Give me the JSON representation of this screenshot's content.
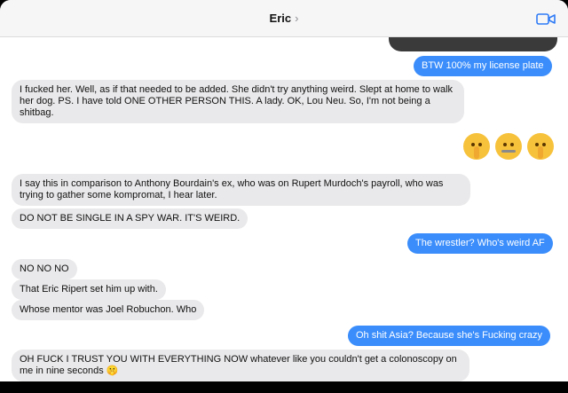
{
  "header": {
    "contact_name": "Eric",
    "chevron": "›",
    "video_icon": "video-camera-icon"
  },
  "colors": {
    "incoming_bubble": "#e9e9eb",
    "outgoing_bubble": "#3a8dfb",
    "header_bg": "#f6f6f7"
  },
  "messages": [
    {
      "from": "me",
      "text": "BTW 100% my license plate"
    },
    {
      "from": "them",
      "text": "I fucked her. Well, as if that needed to be added. She didn't try anything weird. Slept at home to walk her dog. PS. I have told ONE OTHER PERSON THIS. A lady. OK, Lou Neu. So, I'm not being a shitbag."
    },
    {
      "from": "me",
      "text": "🤫🤐🤫"
    },
    {
      "from": "them",
      "text": "I say this in comparison to Anthony Bourdain's ex, who was on Rupert Murdoch's payroll, who was trying to gather some kompromat, I hear later."
    },
    {
      "from": "them",
      "text": "DO NOT BE SINGLE IN A SPY WAR. IT'S WEIRD."
    },
    {
      "from": "me",
      "text": "The wrestler? Who's weird AF"
    },
    {
      "from": "them",
      "text": "NO NO NO"
    },
    {
      "from": "them",
      "text": "That Eric Ripert set him up with."
    },
    {
      "from": "them",
      "text": "Whose mentor was Joel Robuchon. Who"
    },
    {
      "from": "me",
      "text": "Oh shit Asia? Because she's Fucking crazy"
    },
    {
      "from": "them",
      "text": "OH FUCK I TRUST YOU WITH EVERYTHING NOW whatever like you couldn't get a colonoscopy on me in nine seconds 🤫"
    }
  ]
}
